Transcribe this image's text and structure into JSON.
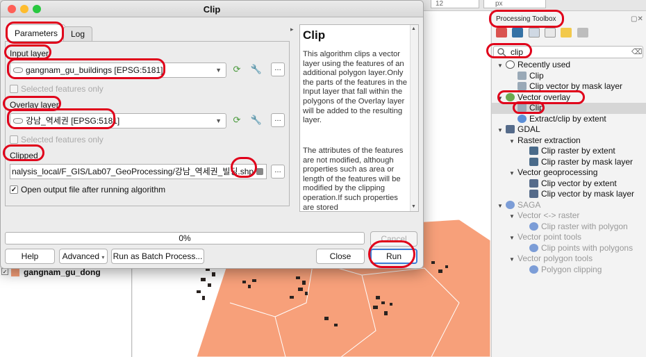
{
  "background": {
    "spinbox_value": "12",
    "unit_combo_value": "px",
    "layer_panel": {
      "layer_name": "gangnam_gu_dong"
    },
    "map_fill_color": "#f7a07a"
  },
  "dialog": {
    "title": "Clip",
    "tabs": [
      "Parameters",
      "Log"
    ],
    "input_layer": {
      "label": "Input layer",
      "value": "gangnam_gu_buildings [EPSG:5181]",
      "selected_only": "Selected features only"
    },
    "overlay_layer": {
      "label": "Overlay layer",
      "value": "강남_역세권 [EPSG:5181]",
      "selected_only": "Selected features only"
    },
    "clipped": {
      "label": "Clipped",
      "value": "nalysis_local/F_GIS/Lab07_GeoProcessing/강남_역세권_빌딩.shp",
      "open_output_label": "Open output file after running algorithm",
      "open_output_checked": true
    },
    "help": {
      "title": "Clip",
      "paragraph1": "This algorithm clips a vector layer using the features of an additional polygon layer.Only the parts of the features in the Input layer that fall within the polygons of the Overlay layer will be added to the resulting layer.",
      "paragraph2": "The attributes of the features are not modified, although properties such as area or length of the features will be modified by the clipping operation.If such properties are stored"
    },
    "progress": {
      "text": "0%",
      "fraction": 0
    },
    "buttons": {
      "cancel": "Cancel",
      "help": "Help",
      "advanced": "Advanced",
      "run_batch": "Run as Batch Process...",
      "close": "Close",
      "run": "Run"
    }
  },
  "toolbox": {
    "title": "Processing Toolbox",
    "search_value": "clip",
    "tree": [
      {
        "label": "Recently used",
        "level": 0,
        "arrow": true,
        "icon": "clock-icon"
      },
      {
        "label": "Clip",
        "level": 1,
        "icon": "clip-tool-icon"
      },
      {
        "label": "Clip vector by mask layer",
        "level": 1,
        "icon": "clip-tool-icon"
      },
      {
        "label": "Vector overlay",
        "level": 0,
        "arrow": true,
        "icon": "qgis-icon"
      },
      {
        "label": "Clip",
        "level": 1,
        "icon": "clip-tool-icon",
        "selected": true
      },
      {
        "label": "Extract/clip by extent",
        "level": 1,
        "icon": "gear-icon"
      },
      {
        "label": "GDAL",
        "level": 0,
        "arrow": true,
        "icon": "gdal-icon"
      },
      {
        "label": "Raster extraction",
        "level": 1,
        "arrow": true
      },
      {
        "label": "Clip raster by extent",
        "level": 2,
        "icon": "raster-icon"
      },
      {
        "label": "Clip raster by mask layer",
        "level": 2,
        "icon": "raster-icon"
      },
      {
        "label": "Vector geoprocessing",
        "level": 1,
        "arrow": true
      },
      {
        "label": "Clip vector by extent",
        "level": 2,
        "icon": "gdal-icon"
      },
      {
        "label": "Clip vector by mask layer",
        "level": 2,
        "icon": "gdal-icon"
      },
      {
        "label": "SAGA",
        "level": 0,
        "arrow": true,
        "icon": "saga-icon",
        "gray": true
      },
      {
        "label": "Vector <-> raster",
        "level": 1,
        "arrow": true,
        "gray": true
      },
      {
        "label": "Clip raster with polygon",
        "level": 2,
        "icon": "saga-icon",
        "gray": true
      },
      {
        "label": "Vector point tools",
        "level": 1,
        "arrow": true,
        "gray": true
      },
      {
        "label": "Clip points with polygons",
        "level": 2,
        "icon": "saga-icon",
        "gray": true
      },
      {
        "label": "Vector polygon tools",
        "level": 1,
        "arrow": true,
        "gray": true
      },
      {
        "label": "Polygon clipping",
        "level": 2,
        "icon": "saga-icon",
        "gray": true
      }
    ]
  },
  "colors": {
    "annotation_red": "#e0001a",
    "run_button_border": "#3a7bd5"
  }
}
